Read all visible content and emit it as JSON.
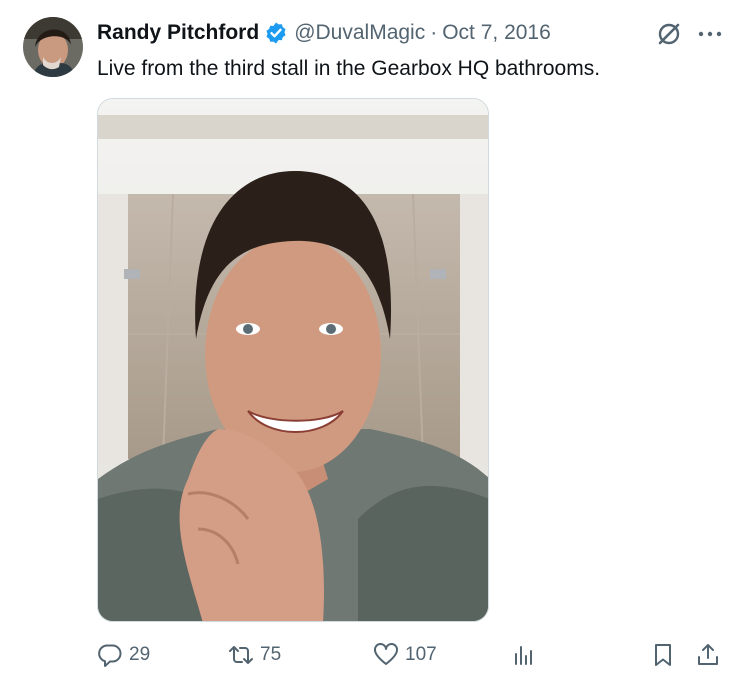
{
  "tweet": {
    "author_name": "Randy Pitchford",
    "handle": "@DuvalMagic",
    "separator": "·",
    "date": "Oct 7, 2016",
    "text": "Live from the third stall in the Gearbox HQ bathrooms."
  },
  "actions": {
    "replies": "29",
    "retweets": "75",
    "likes": "107"
  },
  "colors": {
    "verified_badge": "#1d9bf0",
    "secondary_text": "#536471"
  },
  "icons": [
    "verified-badge-icon",
    "grok-icon",
    "more-icon",
    "reply-icon",
    "retweet-icon",
    "like-icon",
    "views-icon",
    "bookmark-icon",
    "share-icon"
  ]
}
